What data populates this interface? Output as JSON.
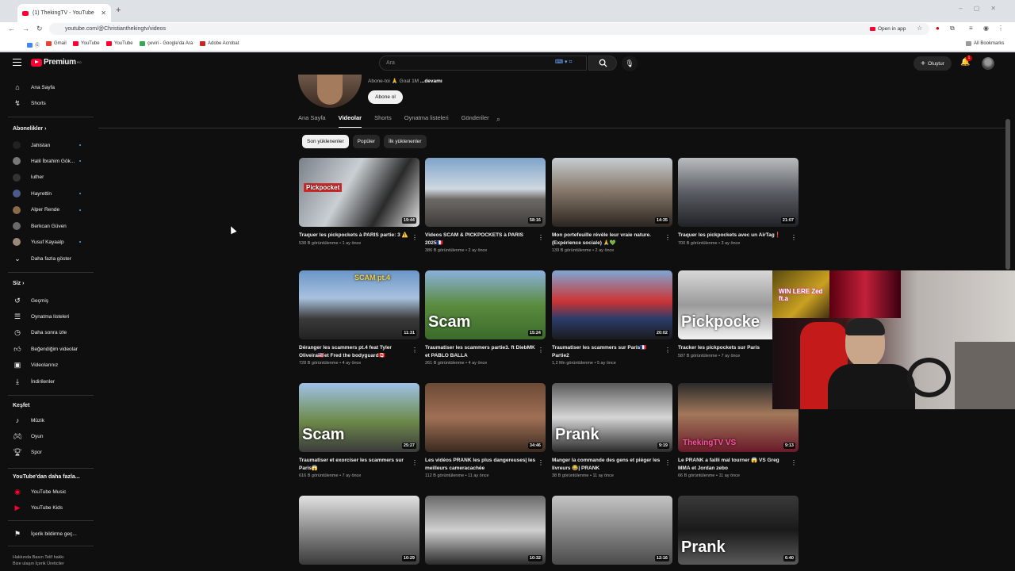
{
  "browser": {
    "tab_title": "(1) ThekingTV - YouTube",
    "url": "youtube.com/@Christianthekingtv/videos",
    "open_in_app": "Open in app",
    "bookmarks": [
      "Gmail",
      "YouTube",
      "YouTube",
      "çeviri - Google'da Ara",
      "Adobe Acrobat"
    ],
    "all_bookmarks": "All Bookmarks"
  },
  "header": {
    "logo_text": "Premium",
    "logo_sup": "RO",
    "search_placeholder": "Ara",
    "create_label": "Oluştur",
    "notif_count": "1"
  },
  "sidebar": {
    "main": [
      {
        "label": "Ana Sayfa",
        "icon": "home-icon"
      },
      {
        "label": "Shorts",
        "icon": "shorts-icon"
      }
    ],
    "subs_title": "Abonelikler",
    "subs": [
      {
        "label": "Jahistan",
        "live": true,
        "color": "#222222"
      },
      {
        "label": "Halil İbrahim Gök...",
        "live": true,
        "color": "#777777"
      },
      {
        "label": "luther",
        "live": false,
        "color": "#333333"
      },
      {
        "label": "Hayrettin",
        "live": true,
        "color": "#4a5a8a"
      },
      {
        "label": "Alper Rende",
        "live": true,
        "color": "#8a6a4a"
      },
      {
        "label": "Berkcan Güven",
        "live": false,
        "color": "#6a6a6a"
      },
      {
        "label": "Yusuf Kayaalp",
        "live": true,
        "color": "#9a8a7a"
      }
    ],
    "show_more": "Daha fazla göster",
    "you_title": "Siz",
    "you": [
      {
        "label": "Geçmiş",
        "icon": "history-icon"
      },
      {
        "label": "Oynatma listeleri",
        "icon": "playlist-icon"
      },
      {
        "label": "Daha sonra izle",
        "icon": "watch-later-icon"
      },
      {
        "label": "Beğendiğim videolar",
        "icon": "like-icon"
      },
      {
        "label": "Videolarınız",
        "icon": "your-videos-icon"
      },
      {
        "label": "İndirilenler",
        "icon": "download-icon"
      }
    ],
    "explore_title": "Keşfet",
    "explore": [
      {
        "label": "Müzik",
        "icon": "music-icon"
      },
      {
        "label": "Oyun",
        "icon": "gaming-icon"
      },
      {
        "label": "Spor",
        "icon": "trophy-icon"
      }
    ],
    "more_title": "YouTube'dan daha fazla...",
    "more": [
      {
        "label": "YouTube Music"
      },
      {
        "label": "YouTube Kids"
      }
    ],
    "report": "İçerik bildirme geç...",
    "footer_1": "Hakkında  Basın  Telif hakkı",
    "footer_2": "Bize ulaşın  İçerik Üreticiler"
  },
  "channel": {
    "desc_prefix": "Abone-toi 🙏 Goal 1M ",
    "desc_more": "...devamı",
    "subscribe": "Abone ol",
    "tabs": [
      "Ana Sayfa",
      "Videolar",
      "Shorts",
      "Oynatma listeleri",
      "Gönderiler"
    ],
    "chips": [
      "Son yüklenenler",
      "Popüler",
      "İlk yüklenenler"
    ]
  },
  "videos": [
    {
      "title": "Traquer les pickpockets à PARIS partie: 3 ⚠️",
      "meta": "538 B görüntülenme • 1 ay önce",
      "dur": "19:44",
      "overlay": "Pickpocket",
      "bg": "linear-gradient(120deg,#7a8088 0%,#c9cfd3 40%,#2a2a2a 70%,#e4e4e4 100%)"
    },
    {
      "title": "Videos SCAM & PICKPOCKETS à PARIS 2025🇫🇷",
      "meta": "386 B görüntülenme • 2 ay önce",
      "dur": "58:16",
      "overlay": "",
      "bg": "linear-gradient(180deg,#7fa3c9 0%,#cfd8e0 45%,#6d6a66 60%,#3d3b3a 100%)"
    },
    {
      "title": "Mon portefeuille révèle leur vraie nature. (Expérience sociale) 🙏💚",
      "meta": "139 B görüntülenme • 2 ay önce",
      "dur": "14:35",
      "overlay": "",
      "bg": "linear-gradient(180deg,#c6cdd3 0%,#8a7d6e 45%,#2b2420 100%)"
    },
    {
      "title": "Traquer les pickpockets avec un AirTag❗",
      "meta": "700 B görüntülenme • 3 ay önce",
      "dur": "21:07",
      "overlay": "",
      "bg": "linear-gradient(180deg,#b9bcbf 0%,#5a5d63 50%,#202226 100%)"
    },
    {
      "title": "Déranger les scammers pt.4 feat Tyler Oliveira🇺🇸et Fred the bodyguard🇨🇦",
      "meta": "728 B görüntülenme • 4 ay önce",
      "dur": "11:31",
      "overlay": "SCAM pt.4",
      "bg": "linear-gradient(180deg,#6a95c8 0%,#a9c2de 40%,#3a3a3a 70%,#222 100%)"
    },
    {
      "title": "Traumatiser les scammers partie3. ft DiebMK et PABLO BALLA",
      "meta": "261 B görüntülenme • 4 ay önce",
      "dur": "15:24",
      "overlay": "Scam",
      "bg": "linear-gradient(180deg,#8ab0dc 0%,#5b8c3f 50%,#3b6a2a 100%)"
    },
    {
      "title": "Traumatiser les scammers sur Paris🇫🇷 Partie2",
      "meta": "1,2 Mn görüntülenme • 5 ay önce",
      "dur": "20:02",
      "overlay": "",
      "bg": "linear-gradient(180deg,#7ea6d4 0%,#c33 45%,#2a3c6a 70%,#1b1b1b 100%)"
    },
    {
      "title": "Tracker les pickpockets sur Paris",
      "meta": "587 B görüntülenme • 7 ay önce",
      "dur": "",
      "overlay": "Pickpocke",
      "bg": "linear-gradient(180deg,#d8d8d8 0%,#9a9a9a 50%,#f2f2f2 100%)"
    },
    {
      "title": "Traumatiser et exorciser les scammers sur Paris😱",
      "meta": "616 B görüntülenme • 7 ay önce",
      "dur": "25:27",
      "overlay": "Scam",
      "bg": "linear-gradient(180deg,#9fc2e6 0%,#6d8a4a 55%,#3b3b3b 100%)"
    },
    {
      "title": "Les vidéos PRANK les plus dangereuses| les meilleurs cameracachée",
      "meta": "112 B görüntülenme • 11 ay önce",
      "dur": "34:46",
      "overlay": "",
      "bg": "linear-gradient(180deg,#6b4a35 0%,#a07055 50%,#3a2a20 100%)"
    },
    {
      "title": "Manger la commande des gens et piéger les livreurs 😂| PRANK",
      "meta": "38 B görüntülenme • 11 ay önce",
      "dur": "9:19",
      "overlay": "Prank",
      "bg": "linear-gradient(180deg,#5a5a5a 0%,#d6d6d6 50%,#2a2a2a 100%)"
    },
    {
      "title": "Le PRANK a failli mal tourner 😱 VS Greg MMA et Jordan zebo",
      "meta": "66 B görüntülenme • 11 ay önce",
      "dur": "9:13",
      "overlay": "ThekingTV VS",
      "bg": "linear-gradient(180deg,#2a2a2a 0%,#a2785a 45%,#6a1a2a 100%)"
    },
    {
      "title": "",
      "meta": "",
      "dur": "10:29",
      "overlay": "",
      "bg": "linear-gradient(180deg,#e2e2e2 0%,#8a8a8a 50%,#3a3a3a 100%)"
    },
    {
      "title": "",
      "meta": "",
      "dur": "10:32",
      "overlay": "",
      "bg": "linear-gradient(180deg,#6a6a6a 0%,#d0d0d0 50%,#2a2a2a 100%)"
    },
    {
      "title": "",
      "meta": "",
      "dur": "12:16",
      "overlay": "",
      "bg": "linear-gradient(180deg,#c4c4c4 0%,#7a7a7a 60%,#4a4a4a 100%)"
    },
    {
      "title": "",
      "meta": "",
      "dur": "6:40",
      "overlay": "Prank",
      "bg": "linear-gradient(180deg,#3a3a3a 0%,#1a1a1a 50%,#5a5a5a 100%)"
    }
  ],
  "webcam_sign": "WIN LERE Zed ft.a",
  "colors": {
    "accent": "#ff0033",
    "bg": "#0f0f0f",
    "chip": "#272727",
    "live": "#3ea6ff"
  }
}
